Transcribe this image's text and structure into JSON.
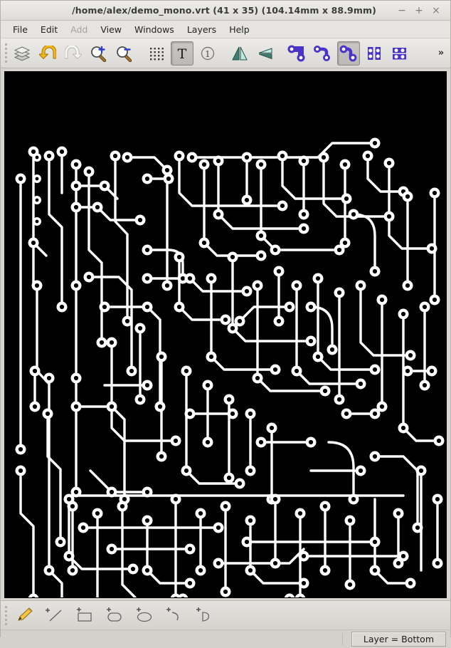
{
  "window": {
    "title": "/home/alex/demo_mono.vrt   (41 x 35)   (104.14mm x 88.9mm)",
    "file_path": "/home/alex/demo_mono.vrt",
    "grid_size": "(41 x 35)",
    "physical_size": "(104.14mm x 88.9mm)",
    "minimize": "−",
    "maximize": "+",
    "close": "×"
  },
  "menubar": {
    "items": [
      {
        "label": "File",
        "disabled": false
      },
      {
        "label": "Edit",
        "disabled": false
      },
      {
        "label": "Add",
        "disabled": true
      },
      {
        "label": "View",
        "disabled": false
      },
      {
        "label": "Windows",
        "disabled": false
      },
      {
        "label": "Layers",
        "disabled": false
      },
      {
        "label": "Help",
        "disabled": false
      }
    ]
  },
  "toolbar": {
    "overflow_label": "»",
    "buttons": [
      {
        "name": "layers-stack-icon",
        "tooltip": "Layers",
        "active": false
      },
      {
        "name": "undo-icon",
        "tooltip": "Undo",
        "active": false
      },
      {
        "name": "redo-icon",
        "tooltip": "Redo",
        "active": false,
        "disabled": true
      },
      {
        "name": "zoom-in-icon",
        "tooltip": "Zoom In",
        "active": false
      },
      {
        "name": "zoom-out-icon",
        "tooltip": "Zoom Out",
        "active": false
      },
      {
        "name": "grid-icon",
        "tooltip": "Grid",
        "active": false
      },
      {
        "name": "text-tool-icon",
        "tooltip": "Text",
        "active": true
      },
      {
        "name": "number-one-icon",
        "tooltip": "Pin 1",
        "active": false
      },
      {
        "name": "mirror-vertical-icon",
        "tooltip": "Mirror Vertical",
        "active": false
      },
      {
        "name": "mirror-horizontal-icon",
        "tooltip": "Mirror Horizontal",
        "active": false
      },
      {
        "name": "trace-corner-icon",
        "tooltip": "Right Angle Trace",
        "active": false
      },
      {
        "name": "trace-step-icon",
        "tooltip": "Step Trace",
        "active": false
      },
      {
        "name": "trace-curve-icon",
        "tooltip": "Curved Trace",
        "active": true
      },
      {
        "name": "pad-array-vertical-icon",
        "tooltip": "Vertical Pad Array",
        "active": false
      },
      {
        "name": "pad-array-horizontal-icon",
        "tooltip": "Horizontal Pad Array",
        "active": false
      }
    ]
  },
  "bottom_toolbar": {
    "buttons": [
      {
        "name": "pencil-tool-icon",
        "tooltip": "Freehand",
        "active": false
      },
      {
        "name": "line-tool-icon",
        "tooltip": "Line",
        "active": false
      },
      {
        "name": "rectangle-tool-icon",
        "tooltip": "Rectangle",
        "active": false
      },
      {
        "name": "rounded-rectangle-tool-icon",
        "tooltip": "Rounded Rectangle",
        "active": false
      },
      {
        "name": "ellipse-tool-icon",
        "tooltip": "Ellipse",
        "active": false
      },
      {
        "name": "arc-tool-icon",
        "tooltip": "Arc",
        "active": false
      },
      {
        "name": "pie-tool-icon",
        "tooltip": "Pie Segment",
        "active": false
      }
    ]
  },
  "statusbar": {
    "layer_label": "Layer = Bottom"
  },
  "canvas": {
    "background_color": "#000000",
    "trace_color": "#ffffff",
    "pad_hole_color": "#000000",
    "description": "PCB layout artwork, bottom copper layer"
  }
}
